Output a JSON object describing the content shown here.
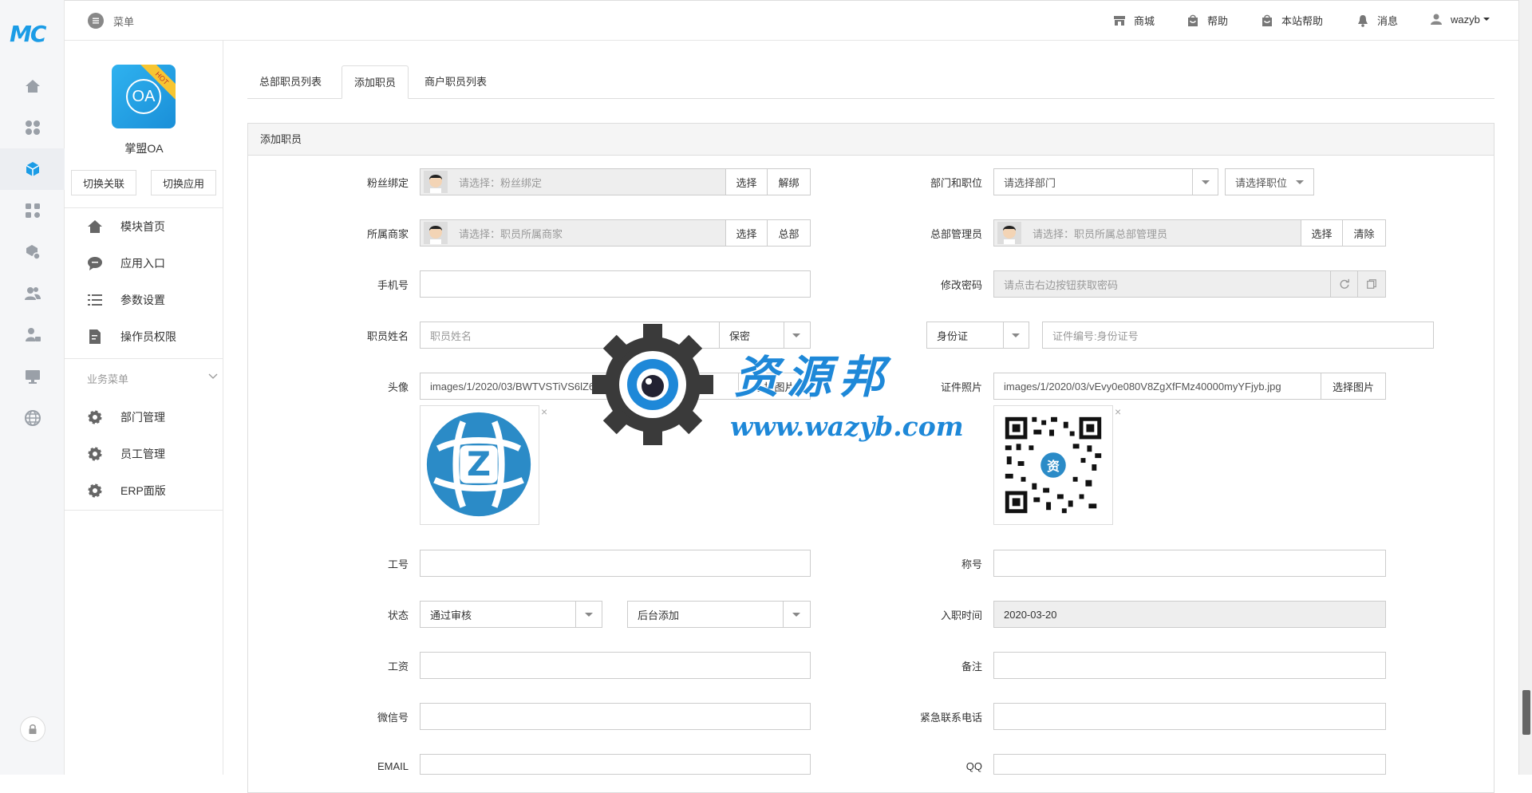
{
  "app": {
    "logo": "MC"
  },
  "header": {
    "menu_label": "菜单",
    "items": {
      "mall": "商城",
      "help": "帮助",
      "site_help": "本站帮助",
      "messages": "消息",
      "user": "wazyb"
    }
  },
  "sidebar": {
    "app_name": "掌盟OA",
    "app_icon_text": "OA",
    "app_badge": "HOT",
    "switch_link_button": "切换关联",
    "switch_app_button": "切换应用",
    "items": [
      "模块首页",
      "应用入口",
      "参数设置",
      "操作员权限"
    ],
    "group_label": "业务菜单",
    "group_items": [
      "部门管理",
      "员工管理",
      "ERP面版"
    ]
  },
  "tabs": [
    "总部职员列表",
    "添加职员",
    "商户职员列表"
  ],
  "panel": {
    "title": "添加职员"
  },
  "form": {
    "fans_label": "粉丝绑定",
    "fans_placeholder": "请选择：粉丝绑定",
    "select_button": "选择",
    "unbind_button": "解绑",
    "dept_label": "部门和职位",
    "dept_placeholder": "请选择部门",
    "position_placeholder": "请选择职位",
    "merchant_label": "所属商家",
    "merchant_placeholder": "请选择：职员所属商家",
    "hq_button": "总部",
    "hq_manager_label": "总部管理员",
    "hq_manager_placeholder": "请选择：职员所属总部管理员",
    "clear_button": "清除",
    "phone_label": "手机号",
    "password_label": "修改密码",
    "password_placeholder": "请点击右边按钮获取密码",
    "name_label": "职员姓名",
    "name_placeholder": "职员姓名",
    "gender_value": "保密",
    "id_type_value": "身份证",
    "id_number_placeholder": "证件编号:身份证号",
    "avatar_label": "头像",
    "avatar_path": "images/1/2020/03/BWTVSTiVS6lZ6X0lS9kGOU3XT1L7.png",
    "choose_image_button": "选择图片",
    "cert_photo_label": "证件照片",
    "cert_photo_path": "images/1/2020/03/vEvy0e080V8ZgXfFMz40000myYFjyb.jpg",
    "remove_mark": "×",
    "avatar_letter": "Z",
    "qr_center": "资",
    "job_no_label": "工号",
    "title_label": "称号",
    "status_label": "状态",
    "status_value": "通过审核",
    "source_value": "后台添加",
    "entry_date_label": "入职时间",
    "entry_date_value": "2020-03-20",
    "salary_label": "工资",
    "remark_label": "备注",
    "wechat_label": "微信号",
    "emergency_label": "紧急联系电话",
    "email_label": "EMAIL",
    "qq_label": "QQ"
  },
  "watermark": {
    "text": "资源邦",
    "url": "www.wazyb.com"
  }
}
